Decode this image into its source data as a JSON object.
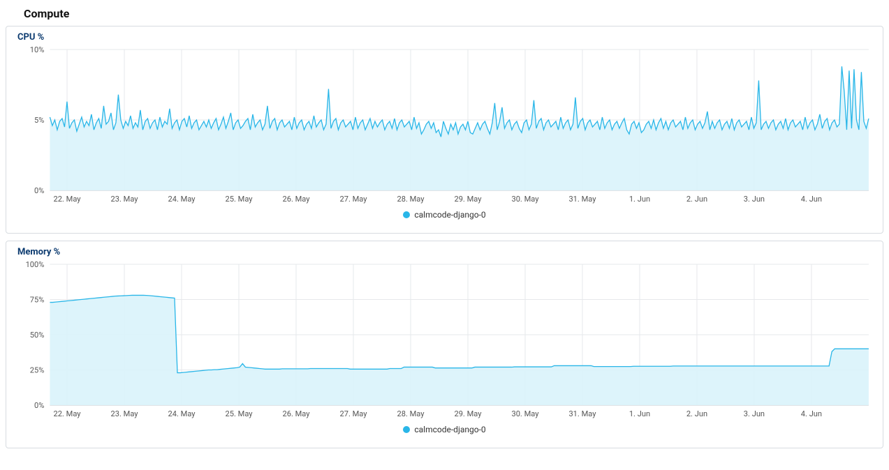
{
  "section": {
    "title": "Compute"
  },
  "legend": {
    "label": "calmcode-django-0",
    "color": "#29b6e8"
  },
  "chart_data": [
    {
      "id": "cpu",
      "type": "area",
      "title": "CPU %",
      "x_categories": [
        "22. May",
        "23. May",
        "24. May",
        "25. May",
        "26. May",
        "27. May",
        "28. May",
        "29. May",
        "30. May",
        "31. May",
        "1. Jun",
        "2. Jun",
        "3. Jun",
        "4. Jun"
      ],
      "y_ticks": [
        "0%",
        "5%",
        "10%"
      ],
      "ylim": [
        0,
        10
      ],
      "series": [
        {
          "name": "calmcode-django-0",
          "values": [
            5.2,
            4.6,
            5.0,
            4.3,
            4.9,
            5.1,
            4.5,
            6.3,
            4.4,
            4.8,
            5.0,
            4.2,
            4.7,
            5.2,
            4.5,
            4.9,
            4.6,
            5.4,
            4.3,
            4.8,
            5.1,
            4.4,
            6.0,
            4.7,
            4.9,
            5.5,
            4.3,
            4.8,
            6.8,
            5.0,
            4.4,
            4.9,
            4.6,
            5.3,
            4.4,
            4.8,
            4.5,
            5.7,
            4.3,
            4.9,
            5.1,
            4.4,
            4.8,
            5.0,
            4.3,
            5.2,
            4.5,
            4.9,
            4.7,
            5.8,
            4.4,
            4.8,
            5.0,
            4.3,
            4.9,
            5.1,
            4.5,
            5.3,
            4.4,
            4.8,
            5.0,
            4.3,
            4.6,
            4.9,
            4.5,
            5.0,
            4.4,
            4.8,
            5.1,
            4.3,
            4.7,
            5.2,
            4.4,
            4.9,
            5.5,
            4.3,
            4.8,
            5.0,
            4.4,
            4.6,
            4.9,
            5.1,
            4.3,
            5.4,
            4.5,
            4.8,
            5.0,
            4.3,
            4.7,
            6.0,
            4.4,
            4.9,
            5.1,
            4.3,
            4.8,
            5.0,
            4.5,
            4.7,
            4.9,
            4.3,
            5.2,
            4.4,
            4.8,
            5.0,
            4.3,
            4.7,
            4.9,
            4.4,
            5.3,
            4.5,
            4.8,
            5.0,
            4.3,
            4.7,
            7.2,
            4.4,
            4.9,
            5.1,
            4.3,
            4.8,
            5.0,
            4.5,
            4.7,
            4.9,
            4.3,
            5.2,
            4.4,
            4.8,
            5.0,
            4.3,
            4.7,
            5.1,
            4.4,
            4.9,
            4.5,
            4.8,
            5.0,
            4.3,
            4.7,
            4.9,
            4.4,
            5.1,
            4.3,
            4.8,
            5.0,
            4.5,
            4.7,
            4.9,
            4.3,
            5.2,
            4.4,
            4.8,
            4.0,
            4.3,
            4.7,
            4.9,
            4.4,
            4.8,
            4.1,
            4.3,
            3.8,
            4.9,
            4.4,
            4.0,
            4.7,
            4.3,
            4.8,
            4.0,
            4.5,
            4.7,
            4.3,
            4.9,
            4.1,
            4.0,
            4.4,
            4.8,
            4.3,
            4.7,
            4.9,
            4.4,
            4.0,
            4.8,
            6.2,
            4.3,
            4.9,
            5.9,
            4.4,
            4.8,
            5.0,
            4.3,
            4.7,
            4.9,
            4.4,
            4.1,
            4.8,
            5.0,
            4.3,
            4.7,
            6.4,
            4.4,
            4.9,
            5.1,
            4.3,
            4.8,
            5.0,
            4.5,
            4.7,
            4.9,
            4.3,
            5.2,
            4.4,
            4.8,
            5.0,
            4.3,
            4.7,
            6.6,
            4.4,
            4.9,
            5.1,
            4.3,
            4.8,
            5.0,
            4.5,
            4.7,
            4.9,
            4.3,
            5.2,
            4.4,
            4.8,
            5.0,
            4.3,
            4.7,
            4.9,
            4.4,
            4.8,
            5.1,
            4.3,
            4.0,
            4.7,
            4.9,
            4.4,
            4.8,
            4.1,
            4.3,
            4.7,
            4.9,
            4.4,
            5.0,
            4.3,
            4.8,
            5.1,
            4.4,
            4.9,
            4.3,
            4.8,
            5.0,
            4.5,
            4.7,
            4.9,
            4.3,
            5.2,
            4.4,
            4.8,
            5.0,
            4.3,
            4.7,
            4.9,
            4.4,
            4.8,
            5.6,
            4.3,
            4.9,
            4.4,
            4.8,
            5.0,
            4.3,
            4.7,
            4.9,
            4.4,
            5.1,
            4.3,
            4.8,
            5.0,
            4.5,
            4.7,
            4.9,
            4.3,
            5.2,
            4.4,
            4.8,
            7.8,
            4.3,
            4.7,
            4.9,
            4.4,
            4.8,
            5.0,
            4.3,
            4.7,
            4.9,
            4.4,
            5.1,
            4.3,
            4.8,
            5.0,
            4.5,
            4.7,
            4.9,
            4.3,
            5.2,
            4.4,
            4.8,
            5.0,
            4.3,
            4.7,
            5.4,
            4.4,
            4.9,
            5.1,
            4.3,
            4.8,
            5.0,
            4.5,
            4.7,
            8.8,
            7.0,
            4.3,
            8.5,
            4.4,
            8.6,
            5.0,
            4.3,
            8.4,
            4.9,
            4.4,
            5.1
          ]
        }
      ]
    },
    {
      "id": "memory",
      "type": "area",
      "title": "Memory %",
      "x_categories": [
        "22. May",
        "23. May",
        "24. May",
        "25. May",
        "26. May",
        "27. May",
        "28. May",
        "29. May",
        "30. May",
        "31. May",
        "1. Jun",
        "2. Jun",
        "3. Jun",
        "4. Jun"
      ],
      "y_ticks": [
        "0%",
        "25%",
        "50%",
        "75%",
        "100%"
      ],
      "ylim": [
        0,
        100
      ],
      "series": [
        {
          "name": "calmcode-django-0",
          "values": [
            73,
            73,
            73.2,
            73.4,
            73.6,
            73.8,
            74,
            74.2,
            74.4,
            74.6,
            74.8,
            75,
            75.2,
            75.4,
            75.6,
            75.8,
            76,
            76.2,
            76.4,
            76.6,
            76.8,
            77,
            77.2,
            77.4,
            77.5,
            77.6,
            77.7,
            77.8,
            77.9,
            78,
            78,
            78,
            78,
            78,
            77.9,
            77.8,
            77.6,
            77.4,
            77.2,
            77,
            76.8,
            76.6,
            76.4,
            76.2,
            76,
            23,
            23,
            23.2,
            23.4,
            23.6,
            23.8,
            24,
            24.2,
            24.4,
            24.6,
            24.8,
            25,
            25,
            25.2,
            25.2,
            25.4,
            25.6,
            25.8,
            26,
            26.2,
            26.4,
            26.6,
            27,
            29.5,
            27,
            26.8,
            26.6,
            26.4,
            26.2,
            26,
            25.8,
            25.6,
            25.6,
            25.6,
            25.6,
            25.6,
            25.6,
            25.8,
            25.8,
            25.8,
            25.8,
            25.8,
            25.8,
            25.8,
            25.8,
            25.8,
            25.8,
            26,
            26,
            26,
            26,
            26,
            26,
            26,
            26,
            26,
            26,
            26,
            26,
            26,
            26,
            25.6,
            25.6,
            25.6,
            25.6,
            25.6,
            25.6,
            25.6,
            25.6,
            25.6,
            25.6,
            25.6,
            25.6,
            25.6,
            25.6,
            26,
            26,
            26,
            26,
            26,
            27,
            27,
            27,
            27,
            27,
            27,
            27,
            27,
            27,
            27,
            27,
            26.4,
            26.4,
            26.4,
            26.4,
            26.4,
            26.4,
            26.4,
            26.4,
            26.4,
            26.4,
            26.4,
            26.4,
            26.4,
            26.4,
            27,
            27,
            27,
            27,
            27,
            27,
            27,
            27,
            27,
            27,
            27,
            27,
            27,
            27,
            27.2,
            27.2,
            27.2,
            27.2,
            27.2,
            27.2,
            27.2,
            27.2,
            27.2,
            27.2,
            27.2,
            27.2,
            27.2,
            27.2,
            28,
            28,
            28,
            28,
            28,
            28,
            28,
            28,
            28,
            28,
            28,
            28,
            28,
            28,
            27.4,
            27.4,
            27.4,
            27.4,
            27.4,
            27.4,
            27.4,
            27.4,
            27.4,
            27.4,
            27.4,
            27.4,
            27.4,
            27.4,
            27.6,
            27.6,
            27.6,
            27.6,
            27.6,
            27.6,
            27.6,
            27.6,
            27.6,
            27.6,
            27.6,
            27.6,
            27.6,
            27.6,
            27.8,
            27.8,
            27.8,
            27.8,
            27.8,
            27.8,
            27.8,
            27.8,
            27.8,
            27.8,
            27.8,
            27.8,
            27.8,
            27.8,
            27.8,
            27.8,
            27.8,
            27.8,
            27.8,
            27.8,
            27.8,
            27.8,
            27.8,
            27.8,
            27.8,
            27.8,
            27.8,
            27.8,
            27.8,
            27.8,
            27.8,
            27.8,
            27.8,
            27.8,
            27.8,
            27.8,
            27.8,
            27.8,
            27.8,
            27.8,
            27.8,
            27.8,
            27.8,
            27.8,
            27.8,
            27.8,
            27.8,
            27.8,
            27.8,
            27.8,
            27.8,
            27.8,
            27.8,
            27.8,
            27.8,
            27.8,
            38,
            40,
            40,
            40,
            40,
            40,
            40,
            40,
            40,
            40,
            40,
            40,
            40,
            40
          ]
        }
      ]
    }
  ]
}
